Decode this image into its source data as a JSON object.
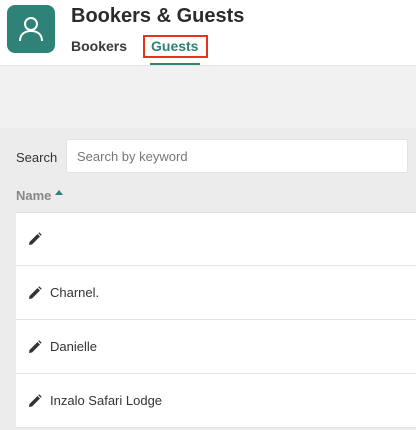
{
  "header": {
    "title": "Bookers & Guests",
    "app_icon": "user-icon",
    "tabs": [
      {
        "label": "Bookers",
        "active": false
      },
      {
        "label": "Guests",
        "active": true
      }
    ]
  },
  "search": {
    "label": "Search",
    "placeholder": "Search by keyword",
    "value": ""
  },
  "table": {
    "columns": [
      {
        "label": "Name",
        "sort": "ascending"
      }
    ],
    "rows": [
      {
        "name": ""
      },
      {
        "name": "Charnel."
      },
      {
        "name": "Danielle"
      },
      {
        "name": "Inzalo Safari Lodge"
      }
    ]
  },
  "colors": {
    "accent": "#2e8278",
    "highlight_box": "#e8331c"
  }
}
